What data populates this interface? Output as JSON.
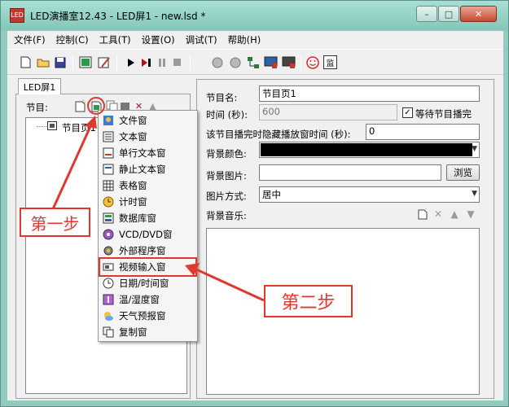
{
  "window": {
    "title": "LED演播室12.43 - LED屏1 - new.lsd *",
    "app_icon_text": "LED"
  },
  "menubar": {
    "items": [
      "文件(F)",
      "控制(C)",
      "工具(T)",
      "设置(O)",
      "调试(T)",
      "帮助(H)"
    ]
  },
  "toolbar": {
    "icons": [
      "new-file-icon",
      "open-folder-icon",
      "save-icon",
      "screen-settings-icon",
      "edit-icon",
      "play-icon",
      "play-step-icon",
      "pause-icon",
      "stop-icon",
      "send-icon",
      "receive-icon",
      "network-icon",
      "screen-on-icon",
      "screen-off-icon",
      "smiley-icon",
      "monitor-icon"
    ],
    "monitor_label": "监"
  },
  "left_panel": {
    "tab_label": "LED屏1",
    "program_label": "节目:",
    "tree_item": "节目页1"
  },
  "popup_menu": {
    "items": [
      {
        "label": "文件窗",
        "icon": "file-window-icon",
        "highlighted": false
      },
      {
        "label": "文本窗",
        "icon": "text-window-icon",
        "highlighted": false
      },
      {
        "label": "单行文本窗",
        "icon": "single-line-text-icon",
        "highlighted": false
      },
      {
        "label": "静止文本窗",
        "icon": "static-text-icon",
        "highlighted": false
      },
      {
        "label": "表格窗",
        "icon": "table-window-icon",
        "highlighted": false
      },
      {
        "label": "计时窗",
        "icon": "timer-icon",
        "highlighted": false
      },
      {
        "label": "数据库窗",
        "icon": "database-icon",
        "highlighted": false
      },
      {
        "label": "VCD/DVD窗",
        "icon": "disc-icon",
        "highlighted": false
      },
      {
        "label": "外部程序窗",
        "icon": "external-program-icon",
        "highlighted": false
      },
      {
        "label": "视频输入窗",
        "icon": "video-input-icon",
        "highlighted": true
      },
      {
        "label": "日期/时间窗",
        "icon": "clock-icon",
        "highlighted": false
      },
      {
        "label": "温/湿度窗",
        "icon": "thermometer-icon",
        "highlighted": false
      },
      {
        "label": "天气预报窗",
        "icon": "weather-icon",
        "highlighted": false
      },
      {
        "label": "复制窗",
        "icon": "copy-window-icon",
        "highlighted": false
      }
    ]
  },
  "right_panel": {
    "program_name_label": "节目名:",
    "program_name_value": "节目页1",
    "time_label": "时间 (秒):",
    "time_value": "600",
    "wait_checkbox_label": "等待节目播完",
    "wait_checkbox_checked": true,
    "hide_time_label": "该节目播完时隐藏播放窗时间 (秒):",
    "hide_time_value": "0",
    "bg_color_label": "背景颜色:",
    "bg_color_value": "#000000",
    "bg_image_label": "背景图片:",
    "bg_image_value": "",
    "browse_button": "浏览",
    "image_mode_label": "图片方式:",
    "image_mode_value": "居中",
    "bg_music_label": "背景音乐:"
  },
  "annotations": {
    "step1": "第一步",
    "step2": "第二步",
    "color": "#e0382e"
  }
}
